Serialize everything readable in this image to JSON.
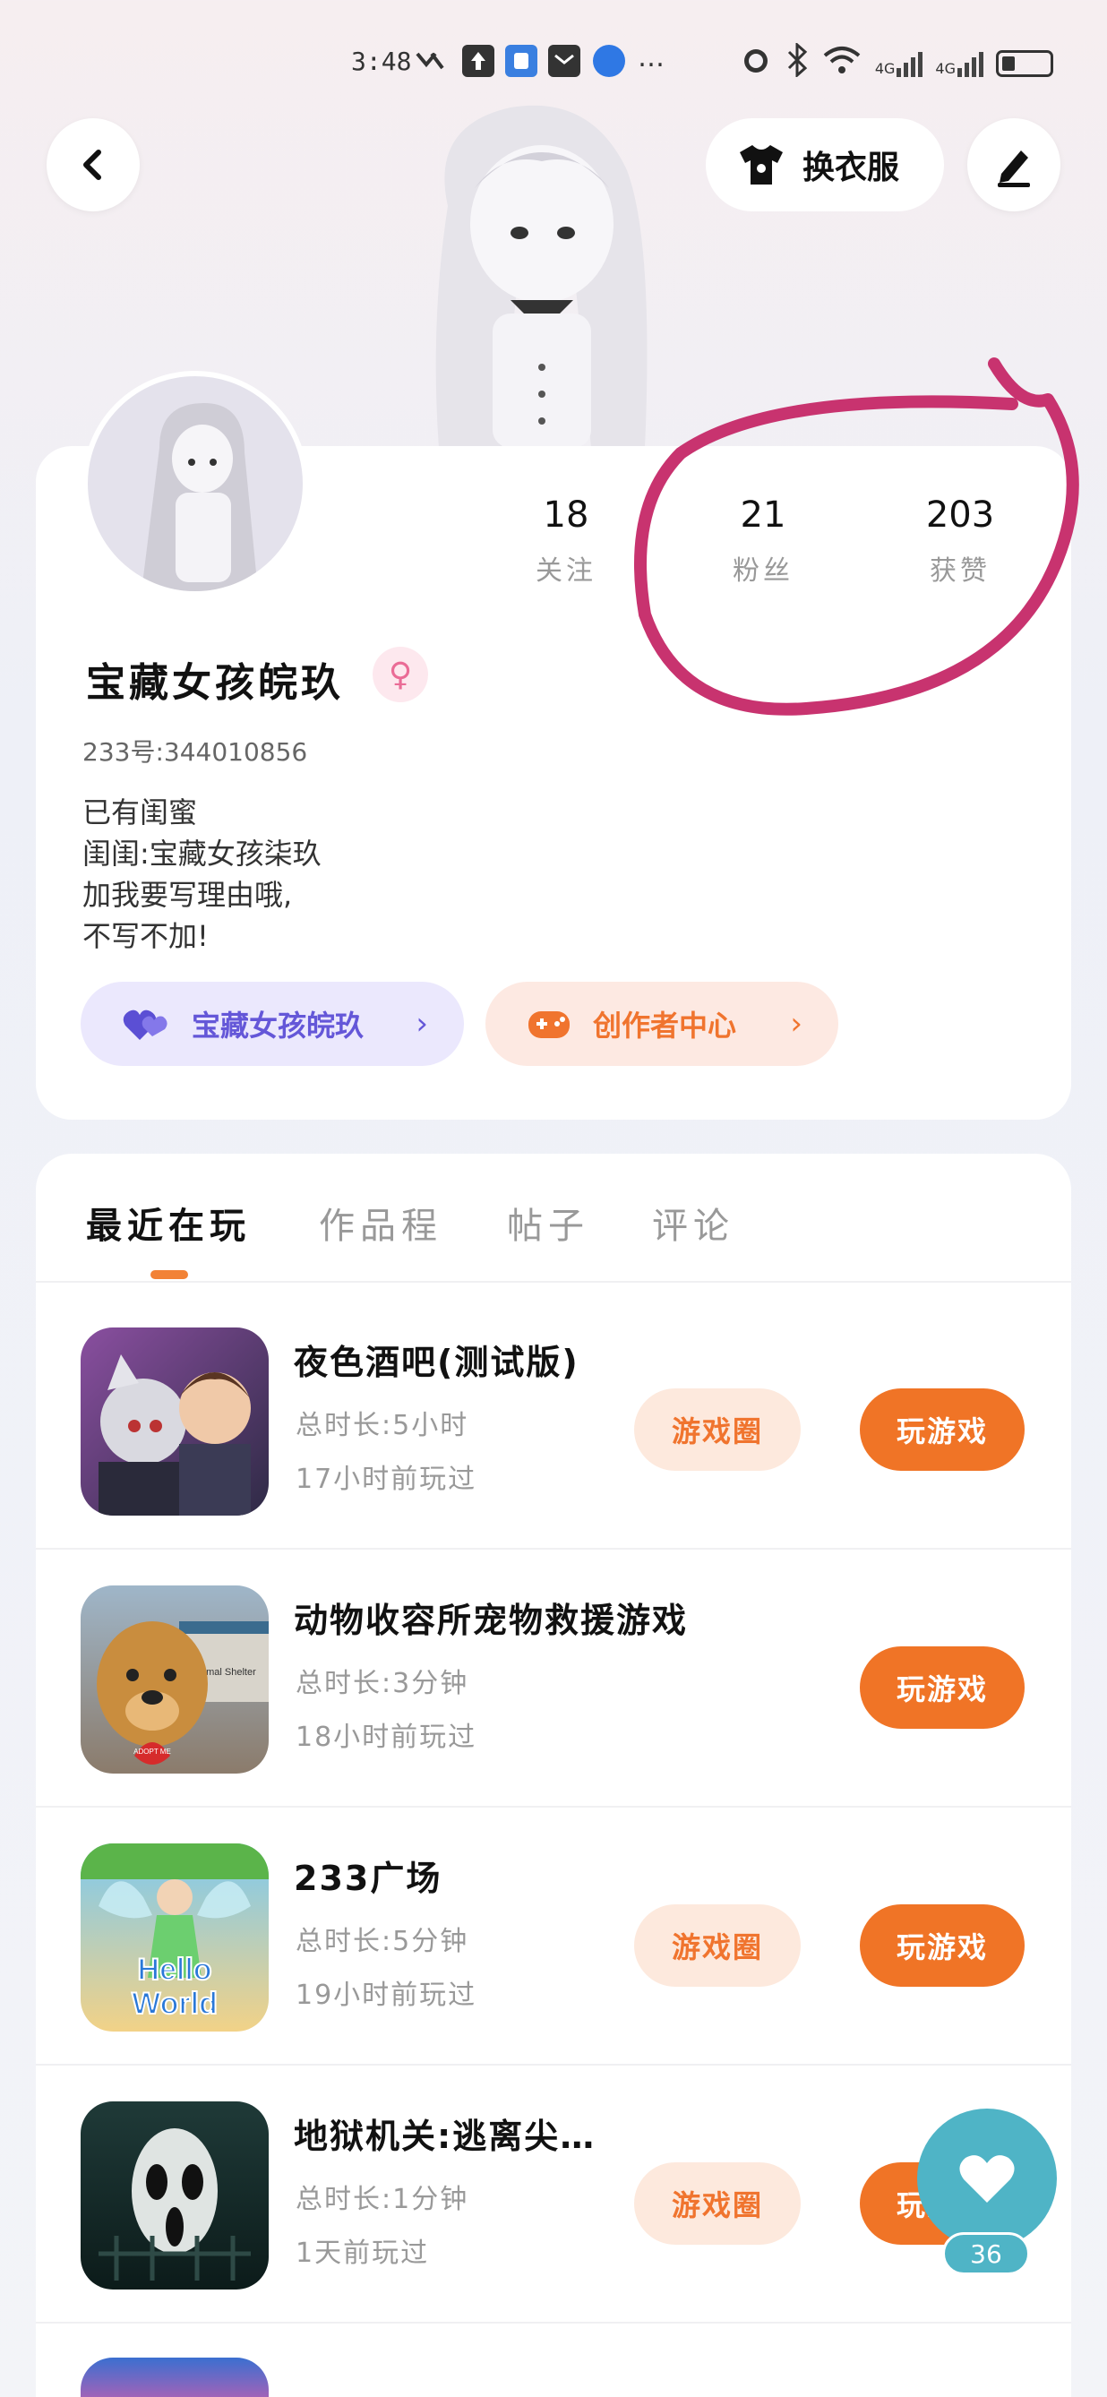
{
  "status_bar": {
    "time": "3:48",
    "network_1": "4G",
    "network_2": "4G",
    "signal_6": "6"
  },
  "header": {
    "back_icon": "chevron-left-icon",
    "dress_label": "换衣服",
    "edit_icon": "pen-icon"
  },
  "profile": {
    "stats": [
      {
        "value": "18",
        "label": "关注"
      },
      {
        "value": "21",
        "label": "粉丝"
      },
      {
        "value": "203",
        "label": "获赞"
      }
    ],
    "username": "宝藏女孩皖玖",
    "gender_symbol": "♀",
    "uid": "233号:344010856",
    "bio_lines": [
      "已有闺蜜",
      "闺闺:宝藏女孩柒玖",
      "加我要写理由哦,",
      "不写不加!"
    ],
    "pill_left": "宝藏女孩皖玖",
    "pill_right": "创作者中心",
    "chevron": "›"
  },
  "tabs": [
    {
      "label": "最近在玩",
      "active": true
    },
    {
      "label": "作品程"
    },
    {
      "label": "帖子"
    },
    {
      "label": "评论"
    }
  ],
  "games": [
    {
      "title": "夜色酒吧(测试版)",
      "duration": "总时长:5小时",
      "last_played": "17小时前玩过",
      "has_circle": true
    },
    {
      "title": "动物收容所宠物救援游戏",
      "duration": "总时长:3分钟",
      "last_played": "18小时前玩过",
      "has_circle": false
    },
    {
      "title": "233广场",
      "duration": "总时长:5分钟",
      "last_played": "19小时前玩过",
      "has_circle": true
    },
    {
      "title": "地狱机关:逃离尖…",
      "duration": "总时长:1分钟",
      "last_played": "1天前玩过",
      "has_circle": true
    }
  ],
  "buttons": {
    "circle": "游戏圈",
    "play": "玩游戏"
  },
  "game_icon_text": {
    "shelter": "Animal Shelter",
    "adopt": "ADOPT ME",
    "hello": "Hello",
    "world": "World"
  },
  "fab": {
    "icon": "heart-icon",
    "count": "36"
  },
  "colors": {
    "accent_orange": "#f07426",
    "accent_purple": "#6457d8",
    "annotation_pink": "#c8336f",
    "fab_teal": "#4fb4c6"
  }
}
